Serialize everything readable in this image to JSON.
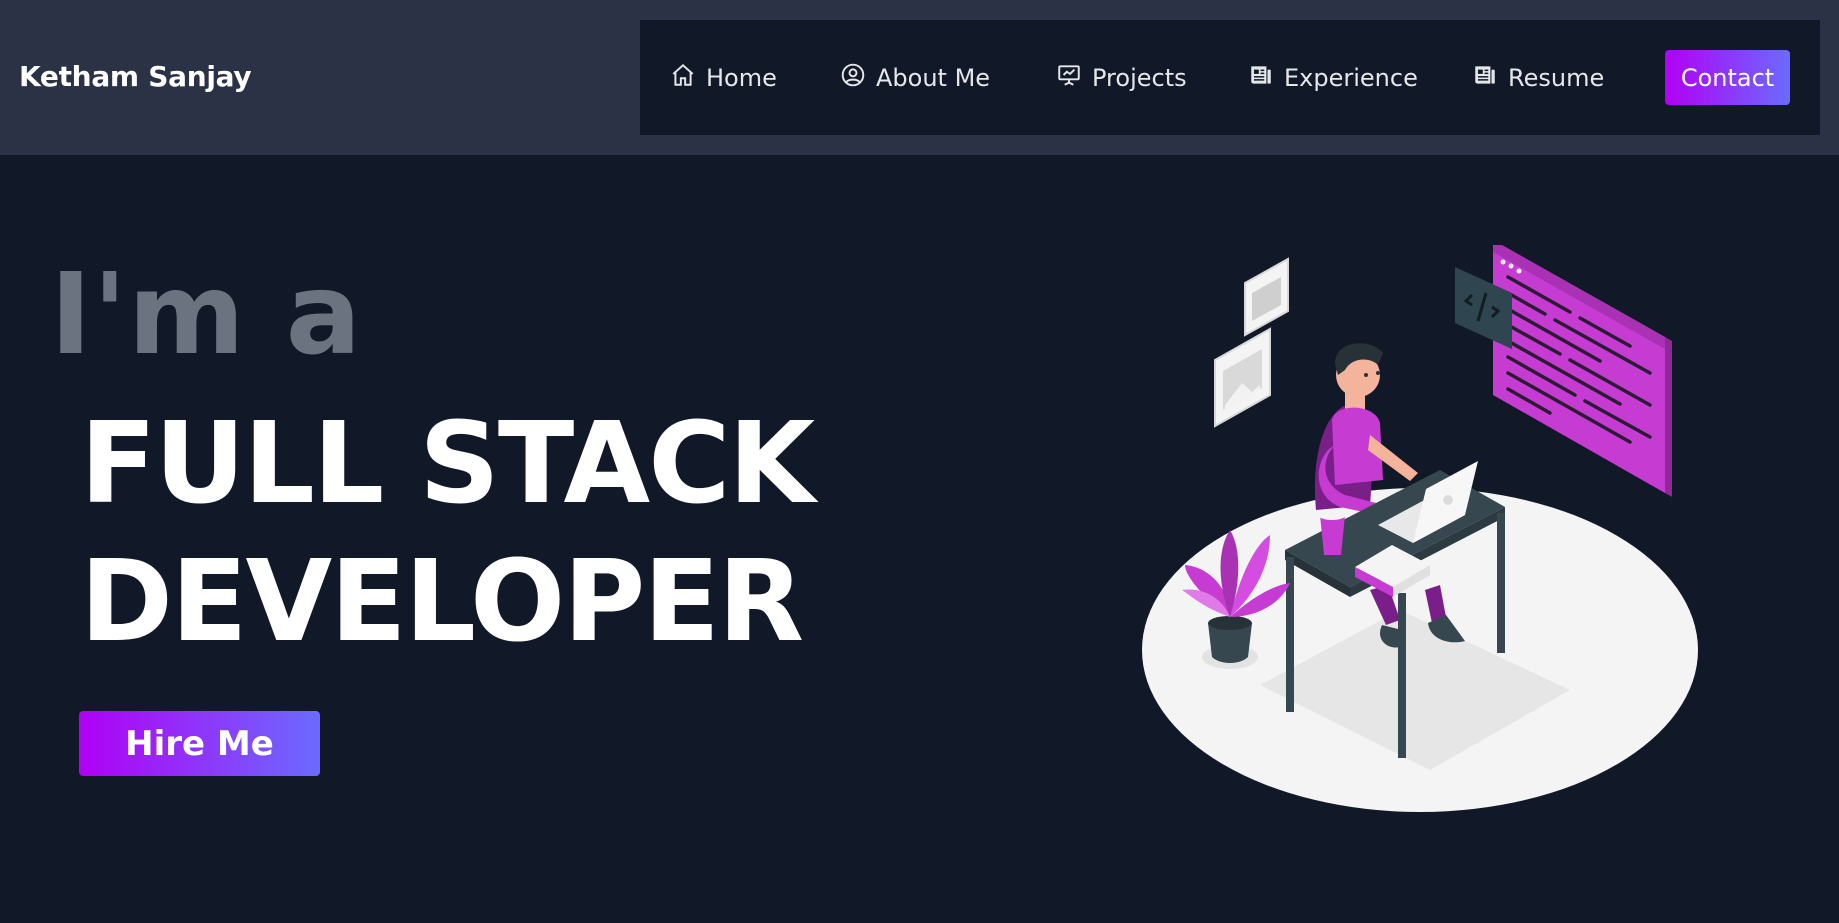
{
  "header": {
    "brand": "Ketham Sanjay",
    "nav": [
      {
        "label": "Home",
        "icon": "home-icon"
      },
      {
        "label": "About Me",
        "icon": "user-circle-icon"
      },
      {
        "label": "Projects",
        "icon": "presentation-chart-icon"
      },
      {
        "label": "Experience",
        "icon": "newspaper-icon"
      },
      {
        "label": "Resume",
        "icon": "newspaper-icon"
      }
    ],
    "contact_label": "Contact"
  },
  "hero": {
    "pre_title": "I'm a",
    "title_line1": "FULL STACK",
    "title_line2": "DEVELOPER",
    "cta_label": "Hire Me"
  },
  "colors": {
    "header_bg": "#2b3245",
    "page_bg": "#111827",
    "accent_gradient_start": "#b100f5",
    "accent_gradient_end": "#6b6bff",
    "illustration_accent": "#c63bd1"
  }
}
